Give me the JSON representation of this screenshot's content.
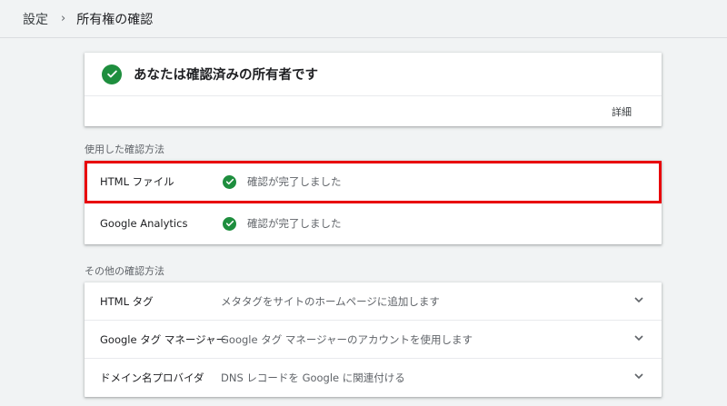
{
  "breadcrumb": {
    "parent": "設定",
    "separator": "›",
    "current": "所有権の確認"
  },
  "owner_card": {
    "title": "あなたは確認済みの所有者です",
    "details_link": "詳細"
  },
  "used_section": {
    "label": "使用した確認方法",
    "rows": [
      {
        "name": "HTML ファイル",
        "status": "確認が完了しました"
      },
      {
        "name": "Google Analytics",
        "status": "確認が完了しました"
      }
    ]
  },
  "other_section": {
    "label": "その他の確認方法",
    "rows": [
      {
        "name": "HTML タグ",
        "description": "メタタグをサイトのホームページに追加します"
      },
      {
        "name": "Google タグ マネージャー",
        "description": "Google タグ マネージャーのアカウントを使用します"
      },
      {
        "name": "ドメイン名プロバイダ",
        "description": "DNS レコードを Google に関連付ける"
      }
    ]
  },
  "colors": {
    "background": "#f1f3f4",
    "check_green": "#1e8e3e",
    "highlight_red": "#e8000b",
    "card": "#ffffff"
  },
  "icons": {
    "verified": "check-circle-icon",
    "expand": "chevron-down-icon"
  }
}
